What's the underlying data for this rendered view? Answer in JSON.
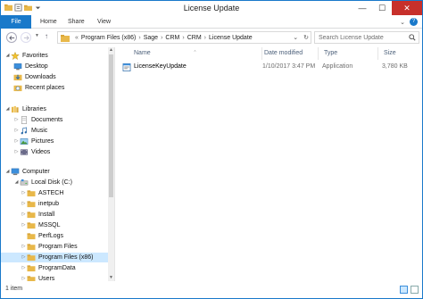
{
  "window": {
    "title": "License Update",
    "controls": {
      "minimize": "—",
      "maximize": "☐",
      "close": "✕"
    }
  },
  "ribbon": {
    "tabs": [
      "File",
      "Home",
      "Share",
      "View"
    ],
    "expand": "⌄",
    "help": "?"
  },
  "address": {
    "prefix": "«",
    "segments": [
      "Program Files (x86)",
      "Sage",
      "CRM",
      "CRM",
      "License Update"
    ],
    "separator": "›",
    "dropdown": "⌄",
    "refresh": "↻"
  },
  "search": {
    "placeholder": "Search License Update"
  },
  "nav": {
    "favorites": {
      "label": "Favorites",
      "items": [
        "Desktop",
        "Downloads",
        "Recent places"
      ]
    },
    "libraries": {
      "label": "Libraries",
      "items": [
        "Documents",
        "Music",
        "Pictures",
        "Videos"
      ]
    },
    "computer": {
      "label": "Computer",
      "disk": "Local Disk (C:)",
      "folders": [
        "ASTECH",
        "inetpub",
        "Install",
        "MSSQL",
        "PerfLogs",
        "Program Files",
        "Program Files (x86)",
        "ProgramData",
        "Users"
      ]
    },
    "selected_folder": "Program Files (x86)"
  },
  "columns": {
    "name": "Name",
    "date": "Date modified",
    "type": "Type",
    "size": "Size"
  },
  "files": [
    {
      "name": "LicenseKeyUpdate",
      "date": "1/10/2017 3:47 PM",
      "type": "Application",
      "size": "3,780 KB"
    }
  ],
  "status": {
    "count": "1 item"
  },
  "colors": {
    "accent": "#1979ca",
    "close": "#c7302b",
    "selection": "#cce8ff",
    "folder": "#e8b84a"
  }
}
